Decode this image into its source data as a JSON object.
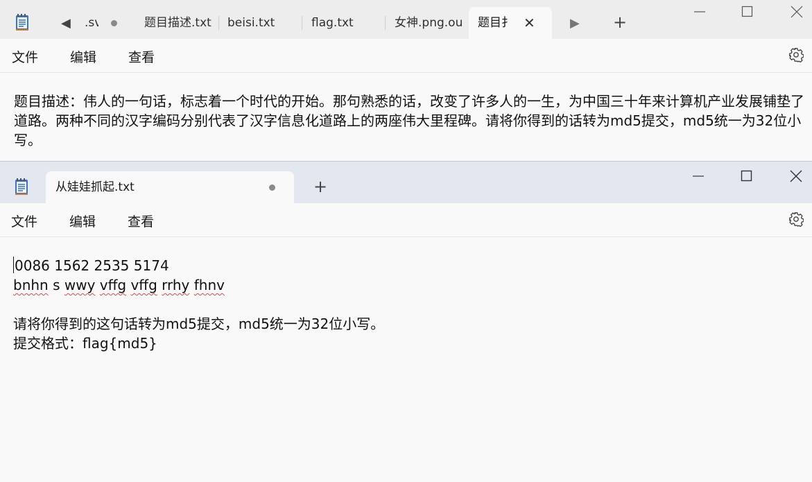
{
  "top_window": {
    "tabs": [
      {
        "label": ".sv",
        "unsaved": true
      },
      {
        "label": "题目描述.txt"
      },
      {
        "label": "beisi.txt"
      },
      {
        "label": "flag.txt"
      },
      {
        "label": "女神.png.ou"
      },
      {
        "label": "题目扌",
        "active": true
      }
    ],
    "new_tab_label": "+",
    "menu": {
      "file": "文件",
      "edit": "编辑",
      "view": "查看"
    },
    "content": "题目描述：伟人的一句话，标志着一个时代的开始。那句熟悉的话，改变了许多人的一生，为中国三十年来计算机产业发展铺垫了道路。两种不同的汉字编码分别代表了汉字信息化道路上的两座伟大里程碑。请将你得到的话转为md5提交，md5统一为32位小写。"
  },
  "bottom_window": {
    "tabs": [
      {
        "label": "从娃娃抓起.txt",
        "active": true,
        "unsaved": true
      }
    ],
    "new_tab_label": "+",
    "menu": {
      "file": "文件",
      "edit": "编辑",
      "view": "查看"
    },
    "lines": {
      "line1": "0086 1562 2535 5174",
      "line2_words": [
        "bnhn",
        "s",
        "wwy",
        "vffg",
        "vffg",
        "rrhy",
        "fhnv"
      ],
      "line3": "请将你得到的这句话转为md5提交，md5统一为32位小写。",
      "line4": "提交格式：flag{md5}"
    }
  },
  "colors": {
    "accent_squiggle": "#e34646",
    "icon_blue": "#3a72c4"
  }
}
